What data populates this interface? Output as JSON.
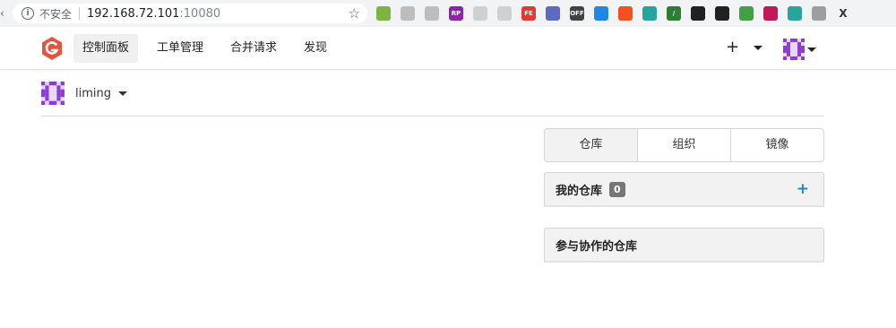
{
  "browser": {
    "security_label": "不安全",
    "url_host": "192.168.72.101",
    "url_port": ":10080",
    "extensions": [
      {
        "name": "ext-1",
        "color": "#7cb342",
        "text": ""
      },
      {
        "name": "ext-2",
        "color": "#bdbdbd",
        "text": ""
      },
      {
        "name": "ext-3",
        "color": "#bdbdbd",
        "text": ""
      },
      {
        "name": "ext-rp",
        "color": "#8e24aa",
        "text": "RP"
      },
      {
        "name": "ext-5",
        "color": "#d0d0d0",
        "text": ""
      },
      {
        "name": "ext-6",
        "color": "#d0d0d0",
        "text": ""
      },
      {
        "name": "ext-fe",
        "color": "#e53935",
        "text": "FE"
      },
      {
        "name": "ext-8",
        "color": "#5c6bc0",
        "text": ""
      },
      {
        "name": "ext-off",
        "color": "#424242",
        "text": "OFF"
      },
      {
        "name": "ext-10",
        "color": "#1e88e5",
        "text": ""
      },
      {
        "name": "ext-11",
        "color": "#f4511e",
        "text": ""
      },
      {
        "name": "ext-12",
        "color": "#26a69a",
        "text": ""
      },
      {
        "name": "ext-13",
        "color": "#2e7d32",
        "text": "/"
      },
      {
        "name": "ext-14",
        "color": "#212121",
        "text": ""
      },
      {
        "name": "ext-15",
        "color": "#212121",
        "text": ""
      },
      {
        "name": "ext-16",
        "color": "#43a047",
        "text": ""
      },
      {
        "name": "ext-17",
        "color": "#c2185b",
        "text": ""
      },
      {
        "name": "ext-18",
        "color": "#26a69a",
        "text": ""
      },
      {
        "name": "ext-19",
        "color": "#9e9e9e",
        "text": ""
      },
      {
        "name": "ext-x",
        "color": "#f1f3f4",
        "text": "X"
      }
    ]
  },
  "navbar": {
    "items": [
      {
        "label": "控制面板",
        "active": true
      },
      {
        "label": "工单管理",
        "active": false
      },
      {
        "label": "合并请求",
        "active": false
      },
      {
        "label": "发现",
        "active": false
      }
    ],
    "plus_label": "+"
  },
  "context": {
    "username": "liming"
  },
  "tabs": [
    {
      "label": "仓库",
      "active": true
    },
    {
      "label": "组织",
      "active": false
    },
    {
      "label": "镜像",
      "active": false
    }
  ],
  "my_repos": {
    "title": "我的仓库",
    "count": "0",
    "add_label": "+"
  },
  "collab_repos": {
    "title": "参与协作的仓库"
  },
  "colors": {
    "logo": "#e5533d",
    "accent": "#2185d0",
    "avatar": "#8a3fcf"
  }
}
